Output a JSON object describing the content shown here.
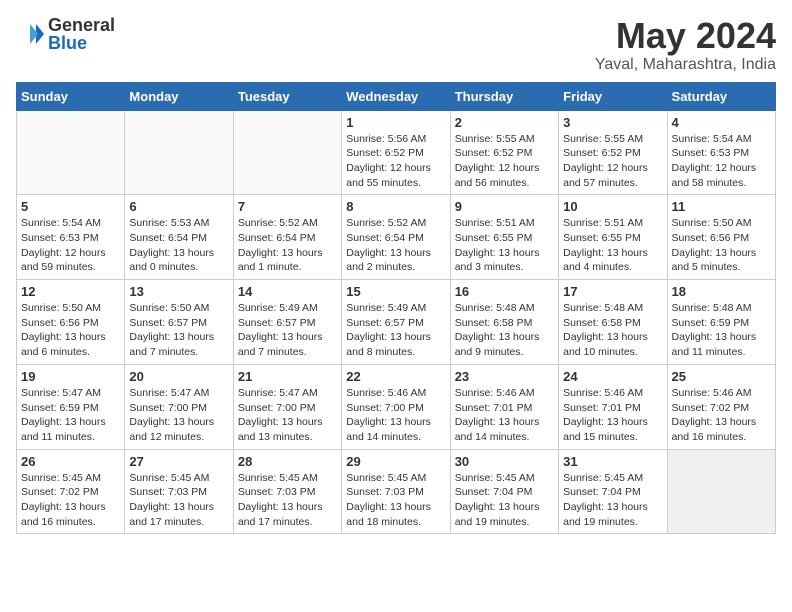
{
  "logo": {
    "general": "General",
    "blue": "Blue"
  },
  "title": {
    "month_year": "May 2024",
    "location": "Yaval, Maharashtra, India"
  },
  "headers": [
    "Sunday",
    "Monday",
    "Tuesday",
    "Wednesday",
    "Thursday",
    "Friday",
    "Saturday"
  ],
  "weeks": [
    [
      {
        "day": "",
        "lines": []
      },
      {
        "day": "",
        "lines": []
      },
      {
        "day": "",
        "lines": []
      },
      {
        "day": "1",
        "lines": [
          "Sunrise: 5:56 AM",
          "Sunset: 6:52 PM",
          "Daylight: 12 hours",
          "and 55 minutes."
        ]
      },
      {
        "day": "2",
        "lines": [
          "Sunrise: 5:55 AM",
          "Sunset: 6:52 PM",
          "Daylight: 12 hours",
          "and 56 minutes."
        ]
      },
      {
        "day": "3",
        "lines": [
          "Sunrise: 5:55 AM",
          "Sunset: 6:52 PM",
          "Daylight: 12 hours",
          "and 57 minutes."
        ]
      },
      {
        "day": "4",
        "lines": [
          "Sunrise: 5:54 AM",
          "Sunset: 6:53 PM",
          "Daylight: 12 hours",
          "and 58 minutes."
        ]
      }
    ],
    [
      {
        "day": "5",
        "lines": [
          "Sunrise: 5:54 AM",
          "Sunset: 6:53 PM",
          "Daylight: 12 hours",
          "and 59 minutes."
        ]
      },
      {
        "day": "6",
        "lines": [
          "Sunrise: 5:53 AM",
          "Sunset: 6:54 PM",
          "Daylight: 13 hours",
          "and 0 minutes."
        ]
      },
      {
        "day": "7",
        "lines": [
          "Sunrise: 5:52 AM",
          "Sunset: 6:54 PM",
          "Daylight: 13 hours",
          "and 1 minute."
        ]
      },
      {
        "day": "8",
        "lines": [
          "Sunrise: 5:52 AM",
          "Sunset: 6:54 PM",
          "Daylight: 13 hours",
          "and 2 minutes."
        ]
      },
      {
        "day": "9",
        "lines": [
          "Sunrise: 5:51 AM",
          "Sunset: 6:55 PM",
          "Daylight: 13 hours",
          "and 3 minutes."
        ]
      },
      {
        "day": "10",
        "lines": [
          "Sunrise: 5:51 AM",
          "Sunset: 6:55 PM",
          "Daylight: 13 hours",
          "and 4 minutes."
        ]
      },
      {
        "day": "11",
        "lines": [
          "Sunrise: 5:50 AM",
          "Sunset: 6:56 PM",
          "Daylight: 13 hours",
          "and 5 minutes."
        ]
      }
    ],
    [
      {
        "day": "12",
        "lines": [
          "Sunrise: 5:50 AM",
          "Sunset: 6:56 PM",
          "Daylight: 13 hours",
          "and 6 minutes."
        ]
      },
      {
        "day": "13",
        "lines": [
          "Sunrise: 5:50 AM",
          "Sunset: 6:57 PM",
          "Daylight: 13 hours",
          "and 7 minutes."
        ]
      },
      {
        "day": "14",
        "lines": [
          "Sunrise: 5:49 AM",
          "Sunset: 6:57 PM",
          "Daylight: 13 hours",
          "and 7 minutes."
        ]
      },
      {
        "day": "15",
        "lines": [
          "Sunrise: 5:49 AM",
          "Sunset: 6:57 PM",
          "Daylight: 13 hours",
          "and 8 minutes."
        ]
      },
      {
        "day": "16",
        "lines": [
          "Sunrise: 5:48 AM",
          "Sunset: 6:58 PM",
          "Daylight: 13 hours",
          "and 9 minutes."
        ]
      },
      {
        "day": "17",
        "lines": [
          "Sunrise: 5:48 AM",
          "Sunset: 6:58 PM",
          "Daylight: 13 hours",
          "and 10 minutes."
        ]
      },
      {
        "day": "18",
        "lines": [
          "Sunrise: 5:48 AM",
          "Sunset: 6:59 PM",
          "Daylight: 13 hours",
          "and 11 minutes."
        ]
      }
    ],
    [
      {
        "day": "19",
        "lines": [
          "Sunrise: 5:47 AM",
          "Sunset: 6:59 PM",
          "Daylight: 13 hours",
          "and 11 minutes."
        ]
      },
      {
        "day": "20",
        "lines": [
          "Sunrise: 5:47 AM",
          "Sunset: 7:00 PM",
          "Daylight: 13 hours",
          "and 12 minutes."
        ]
      },
      {
        "day": "21",
        "lines": [
          "Sunrise: 5:47 AM",
          "Sunset: 7:00 PM",
          "Daylight: 13 hours",
          "and 13 minutes."
        ]
      },
      {
        "day": "22",
        "lines": [
          "Sunrise: 5:46 AM",
          "Sunset: 7:00 PM",
          "Daylight: 13 hours",
          "and 14 minutes."
        ]
      },
      {
        "day": "23",
        "lines": [
          "Sunrise: 5:46 AM",
          "Sunset: 7:01 PM",
          "Daylight: 13 hours",
          "and 14 minutes."
        ]
      },
      {
        "day": "24",
        "lines": [
          "Sunrise: 5:46 AM",
          "Sunset: 7:01 PM",
          "Daylight: 13 hours",
          "and 15 minutes."
        ]
      },
      {
        "day": "25",
        "lines": [
          "Sunrise: 5:46 AM",
          "Sunset: 7:02 PM",
          "Daylight: 13 hours",
          "and 16 minutes."
        ]
      }
    ],
    [
      {
        "day": "26",
        "lines": [
          "Sunrise: 5:45 AM",
          "Sunset: 7:02 PM",
          "Daylight: 13 hours",
          "and 16 minutes."
        ]
      },
      {
        "day": "27",
        "lines": [
          "Sunrise: 5:45 AM",
          "Sunset: 7:03 PM",
          "Daylight: 13 hours",
          "and 17 minutes."
        ]
      },
      {
        "day": "28",
        "lines": [
          "Sunrise: 5:45 AM",
          "Sunset: 7:03 PM",
          "Daylight: 13 hours",
          "and 17 minutes."
        ]
      },
      {
        "day": "29",
        "lines": [
          "Sunrise: 5:45 AM",
          "Sunset: 7:03 PM",
          "Daylight: 13 hours",
          "and 18 minutes."
        ]
      },
      {
        "day": "30",
        "lines": [
          "Sunrise: 5:45 AM",
          "Sunset: 7:04 PM",
          "Daylight: 13 hours",
          "and 19 minutes."
        ]
      },
      {
        "day": "31",
        "lines": [
          "Sunrise: 5:45 AM",
          "Sunset: 7:04 PM",
          "Daylight: 13 hours",
          "and 19 minutes."
        ]
      },
      {
        "day": "",
        "lines": []
      }
    ]
  ]
}
